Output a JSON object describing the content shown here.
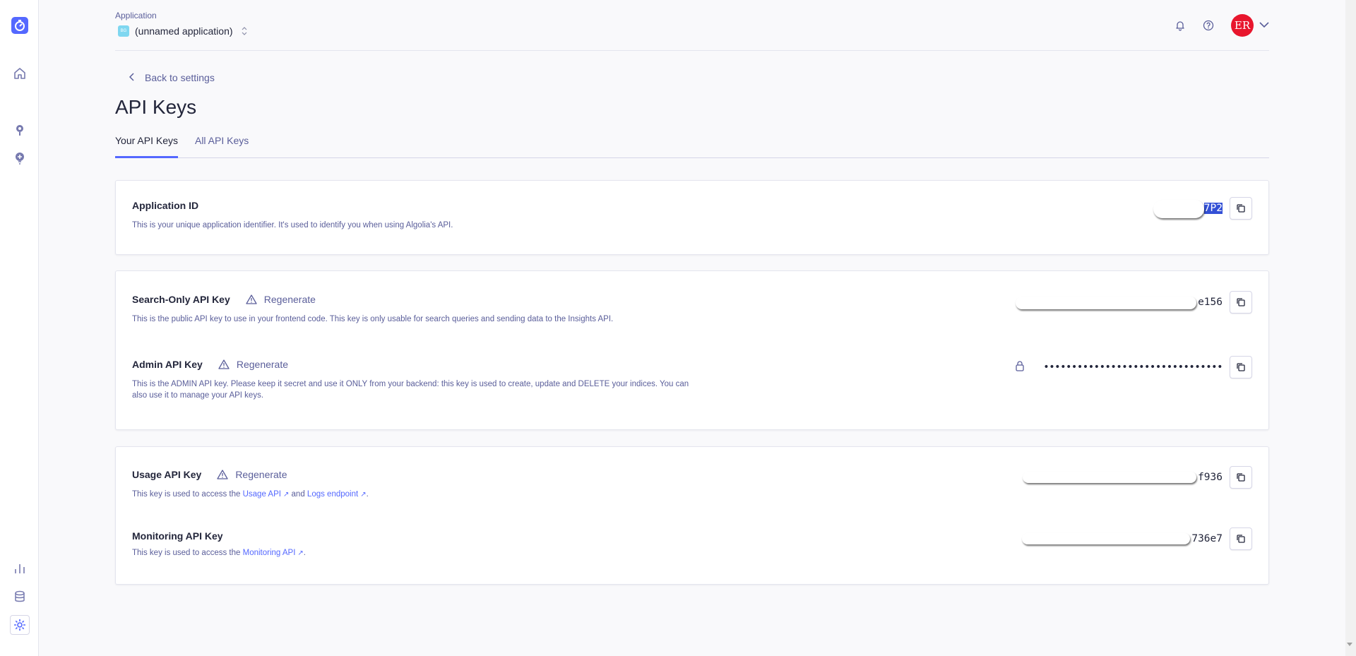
{
  "header": {
    "app_label": "Application",
    "app_badge": "BG",
    "app_name": "(unnamed application)",
    "avatar_initials": "ER"
  },
  "page": {
    "back_link": "Back to settings",
    "title": "API Keys",
    "tabs": [
      {
        "label": "Your API Keys",
        "active": true
      },
      {
        "label": "All API Keys",
        "active": false
      }
    ]
  },
  "keys": {
    "app_id": {
      "title": "Application ID",
      "description": "This is your unique application identifier. It's used to identify you when using Algolia's API.",
      "value_suffix": "7P2"
    },
    "search_only": {
      "title": "Search-Only API Key",
      "regenerate": "Regenerate",
      "description": "This is the public API key to use in your frontend code. This key is only usable for search queries and sending data to the Insights API.",
      "value_suffix": "e156"
    },
    "admin": {
      "title": "Admin API Key",
      "regenerate": "Regenerate",
      "description": "This is the ADMIN API key. Please keep it secret and use it ONLY from your backend: this key is used to create, update and DELETE your indices. You can also use it to manage your API keys.",
      "masked_value": "••••••••••••••••••••••••••••••••"
    },
    "usage": {
      "title": "Usage API Key",
      "regenerate": "Regenerate",
      "desc_prefix": "This key is used to access the ",
      "link1": "Usage API",
      "desc_mid": " and ",
      "link2": "Logs endpoint",
      "desc_suffix": ".",
      "value_suffix": "f936"
    },
    "monitoring": {
      "title": "Monitoring API Key",
      "desc_prefix": "This key is used to access the ",
      "link1": "Monitoring API",
      "desc_suffix": ".",
      "value_suffix": "736e7"
    }
  },
  "colors": {
    "accent": "#5468ff",
    "avatar": "#e8162d",
    "text": "#23263b",
    "muted": "#5a5e9a"
  }
}
